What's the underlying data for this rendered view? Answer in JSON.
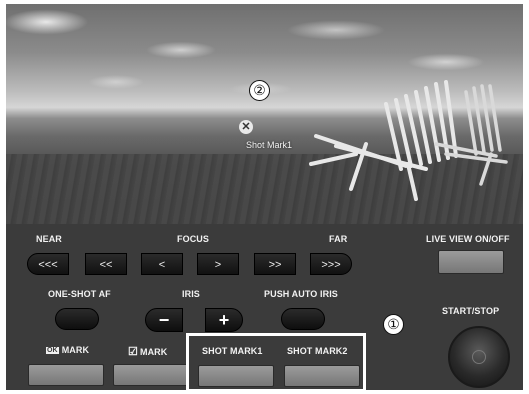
{
  "callouts": {
    "one": "①",
    "two": "②"
  },
  "viewfinder": {
    "marker_icon": "✕",
    "shot_mark_label": "Shot Mark1"
  },
  "focus": {
    "near_label": "NEAR",
    "focus_label": "FOCUS",
    "far_label": "FAR",
    "buttons": [
      "<<<",
      "<<",
      "<",
      ">",
      ">>",
      ">>>"
    ]
  },
  "live_view_label": "LIVE VIEW ON/OFF",
  "one_shot_af_label": "ONE-SHOT AF",
  "iris": {
    "label": "IRIS",
    "minus": "−",
    "plus": "+"
  },
  "push_auto_iris_label": "PUSH AUTO IRIS",
  "start_stop_label": "START/STOP",
  "marks": {
    "ok_mark_icon": "OK",
    "ok_mark_label": "MARK",
    "check_mark_icon": "☑",
    "check_mark_label": "MARK",
    "shot_mark1_label": "SHOT MARK1",
    "shot_mark2_label": "SHOT MARK2"
  },
  "colors": {
    "panel": "#3b3b3b",
    "highlight": "#ffffff",
    "button_gray": "#8a8a8a"
  }
}
